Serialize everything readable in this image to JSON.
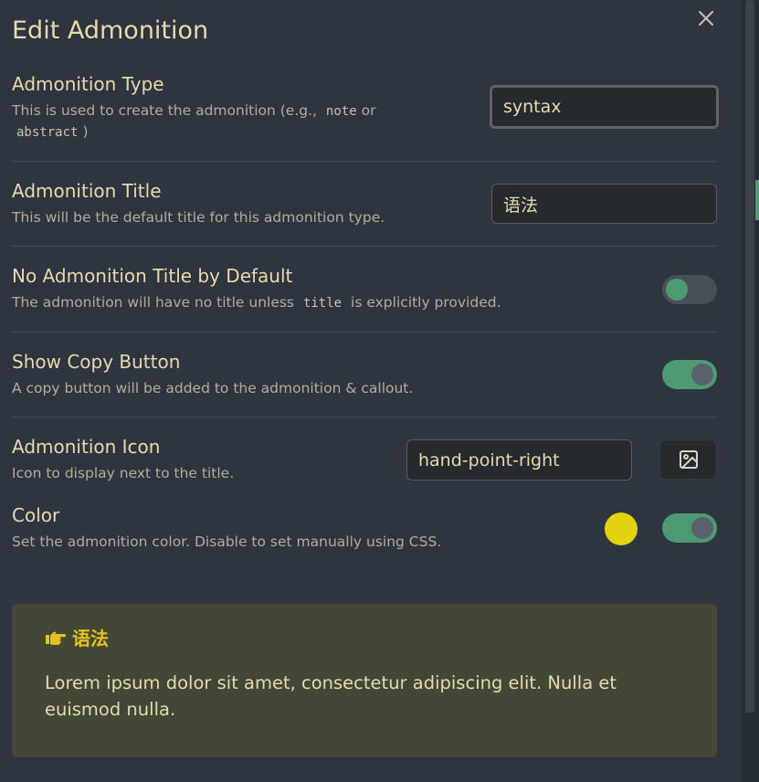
{
  "modal": {
    "title": "Edit Admonition",
    "close_glyph": "✕",
    "close_icon": "close-icon"
  },
  "type": {
    "name": "Admonition Type",
    "desc_prefix": "This is used to create the admonition (e.g.,",
    "desc_code1": "note",
    "desc_or": "or",
    "desc_code2": "abstract",
    "desc_suffix": ")",
    "value": "syntax"
  },
  "title_setting": {
    "name": "Admonition Title",
    "desc": "This will be the default title for this admonition type.",
    "value": "语法"
  },
  "no_title": {
    "name": "No Admonition Title by Default",
    "desc_prefix": "The admonition will have no title unless",
    "desc_code": "title",
    "desc_suffix": "is explicitly provided.",
    "enabled": false
  },
  "copy_button": {
    "name": "Show Copy Button",
    "desc": "A copy button will be added to the admonition & callout.",
    "enabled": true
  },
  "icon": {
    "name": "Admonition Icon",
    "desc": "Icon to display next to the title.",
    "value": "hand-point-right",
    "picker_icon": "image-icon"
  },
  "color": {
    "name": "Color",
    "desc": "Set the admonition color. Disable to set manually using CSS.",
    "value": "#e2d20f",
    "enabled": true
  },
  "preview": {
    "icon": "hand-point-right-icon",
    "icon_glyph": "👉",
    "title": "语法",
    "body": "Lorem ipsum dolor sit amet, consectetur adipiscing elit. Nulla et euismod nulla.",
    "title_color": "#e2c51a",
    "background": "#434736"
  },
  "colors": {
    "accent_green": "#4e9a72",
    "text": "#e7d9b0",
    "muted": "#b2ad9f"
  }
}
